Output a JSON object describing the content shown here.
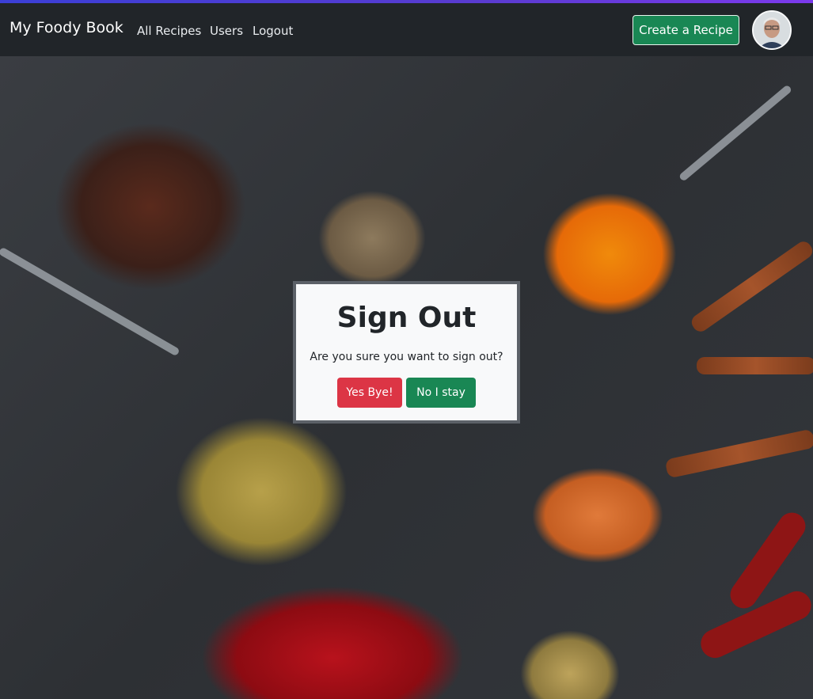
{
  "nav": {
    "brand": "My Foody Book",
    "links": [
      "All Recipes",
      "Users",
      "Logout"
    ],
    "create_label": "Create a Recipe"
  },
  "modal": {
    "title": "Sign Out",
    "message": "Are you sure you want to sign out?",
    "confirm_label": "Yes Bye!",
    "cancel_label": "No I stay"
  },
  "colors": {
    "navbar": "#212529",
    "success": "#198754",
    "danger": "#dc3545"
  }
}
